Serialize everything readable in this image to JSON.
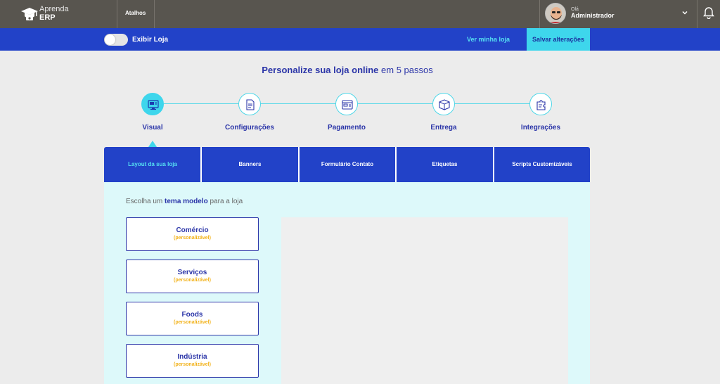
{
  "app": {
    "logo_line1": "Aprenda",
    "logo_line2": "ERP"
  },
  "topbar": {
    "shortcuts": "Atalhos",
    "greeting": "Olá",
    "user_name": "Administrador"
  },
  "store_bar": {
    "toggle_label": "Exibir Loja",
    "view_store": "Ver minha loja",
    "save": "Salvar alterações"
  },
  "heading": {
    "bold": "Personalize sua loja online",
    "rest": " em 5 passos"
  },
  "steps": [
    {
      "label": "Visual",
      "icon": "monitor-icon",
      "active": true
    },
    {
      "label": "Configurações",
      "icon": "document-icon",
      "active": false
    },
    {
      "label": "Pagamento",
      "icon": "payment-icon",
      "active": false
    },
    {
      "label": "Entrega",
      "icon": "box-icon",
      "active": false
    },
    {
      "label": "Integrações",
      "icon": "puzzle-icon",
      "active": false
    }
  ],
  "tabs": [
    {
      "label": "Layout da sua loja",
      "active": true
    },
    {
      "label": "Banners",
      "active": false
    },
    {
      "label": "Formulário Contato",
      "active": false
    },
    {
      "label": "Etiquetas",
      "active": false
    },
    {
      "label": "Scripts Customizáveis",
      "active": false
    }
  ],
  "content": {
    "prompt_pre": "Escolha um ",
    "prompt_bold": "tema modelo",
    "prompt_post": " para a loja",
    "themes": [
      {
        "name": "Comércio",
        "tag": "(personalizável)"
      },
      {
        "name": "Serviços",
        "tag": "(personalizável)"
      },
      {
        "name": "Foods",
        "tag": "(personalizável)"
      },
      {
        "name": "Indústria",
        "tag": "(personalizável)"
      }
    ]
  },
  "colors": {
    "topbar": "#58554f",
    "primary": "#2242c8",
    "accent": "#3ed6ec",
    "content_bg": "#ddf9fa",
    "tag": "#f2b21a"
  }
}
